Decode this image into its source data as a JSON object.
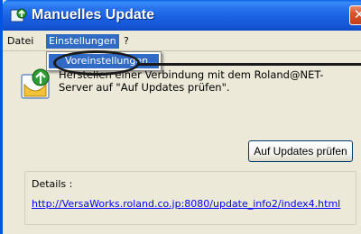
{
  "window": {
    "title": "Manuelles Update",
    "close_glyph": "✕"
  },
  "menubar": {
    "items": [
      "Datei",
      "Einstellungen",
      "?"
    ],
    "active_index": 1
  },
  "dropdown": {
    "items": [
      "Voreinstellungen..."
    ]
  },
  "content": {
    "message": "Herstellen einer Verbindung mit dem Roland@NET-Server auf \"Auf Updates prüfen\".",
    "check_button_label": "Auf Updates prüfen",
    "details_label": "Details :",
    "details_link": "http://VersaWorks.roland.co.jp:8080/update_info2/index4.html"
  },
  "icons": {
    "app": "update-app-icon",
    "update": "globe-download-icon"
  },
  "colors": {
    "titlebar": "#1a62e2",
    "menu_highlight": "#316ac5",
    "link": "#0000ff",
    "window_bg": "#ece9d8"
  }
}
